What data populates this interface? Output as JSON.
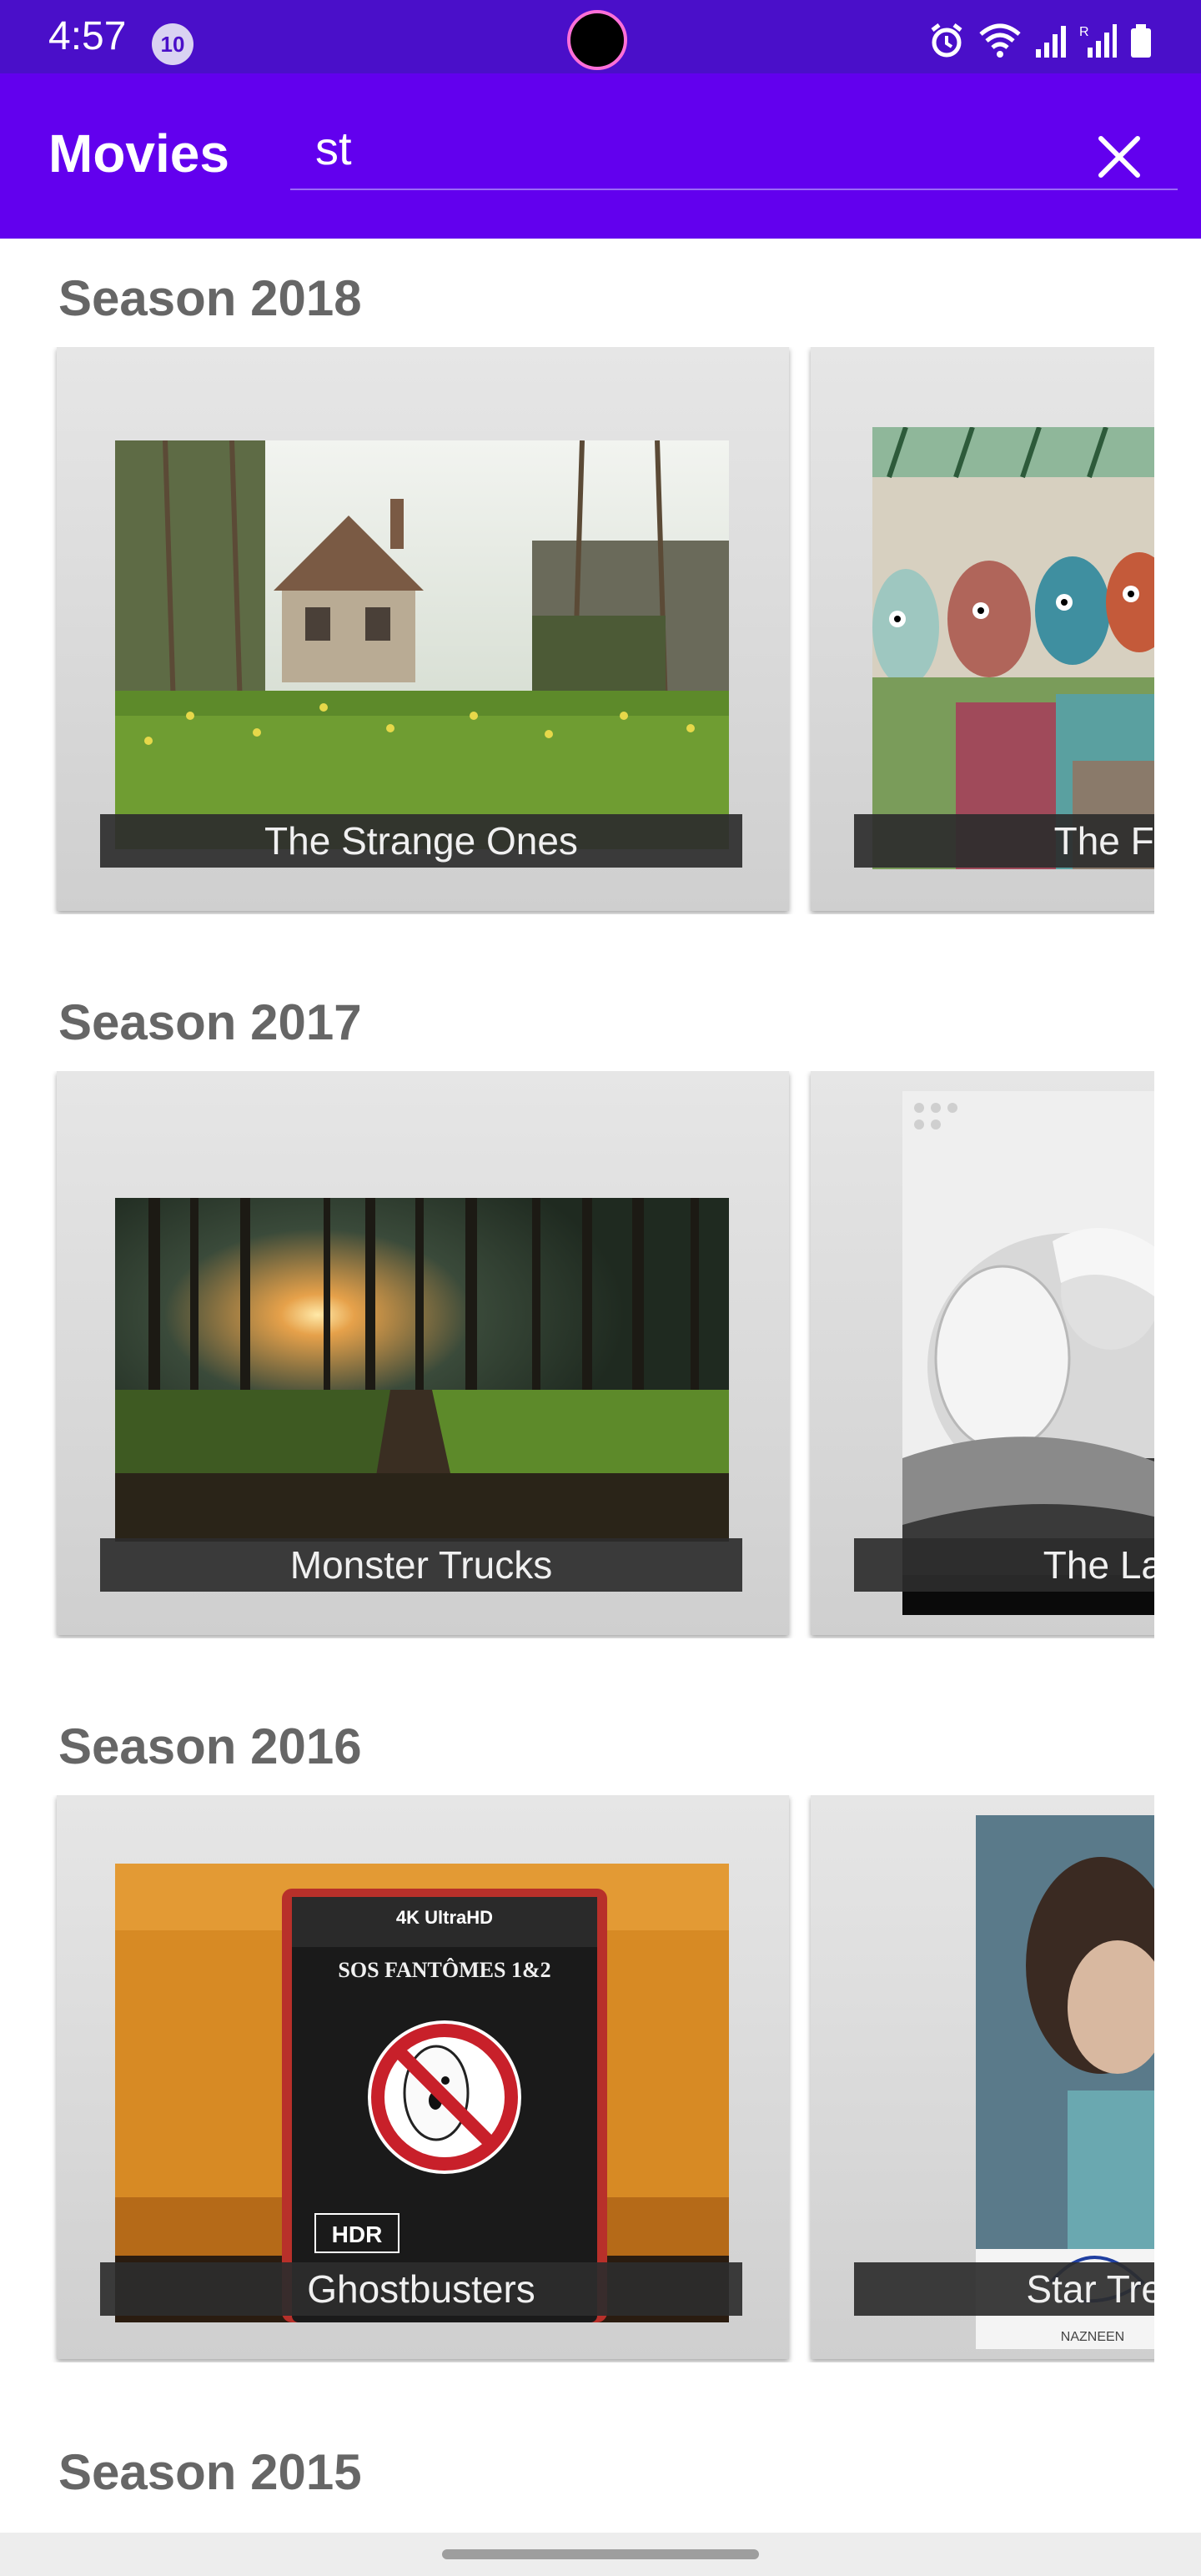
{
  "status_bar": {
    "time": "4:57",
    "notification_count": "10",
    "icons": [
      "alarm-icon",
      "wifi-icon",
      "signal-icon",
      "signal-r-icon",
      "battery-icon"
    ]
  },
  "app_bar": {
    "title": "Movies",
    "search_value": "st",
    "close_icon": "close-icon",
    "color": "#6200ee"
  },
  "sections": [
    {
      "title": "Season 2018",
      "cards": [
        {
          "title": "The Strange Ones",
          "image": "countryside-cottage"
        },
        {
          "title": "The Fi",
          "image": "cartoon-crowd"
        }
      ]
    },
    {
      "title": "Season 2017",
      "cards": [
        {
          "title": "Monster Trucks",
          "image": "forest-sunset"
        },
        {
          "title": "The La",
          "image": "bw-portrait"
        }
      ]
    },
    {
      "title": "Season 2016",
      "cards": [
        {
          "title": "Ghostbusters",
          "image": "bluray-box"
        },
        {
          "title": "Star Tre",
          "image": "signed-photo"
        }
      ]
    },
    {
      "title": "Season 2015",
      "cards": []
    }
  ],
  "colors": {
    "status_bar": "#4a0fc9",
    "app_bar": "#6200ee",
    "section_title": "#666666"
  }
}
